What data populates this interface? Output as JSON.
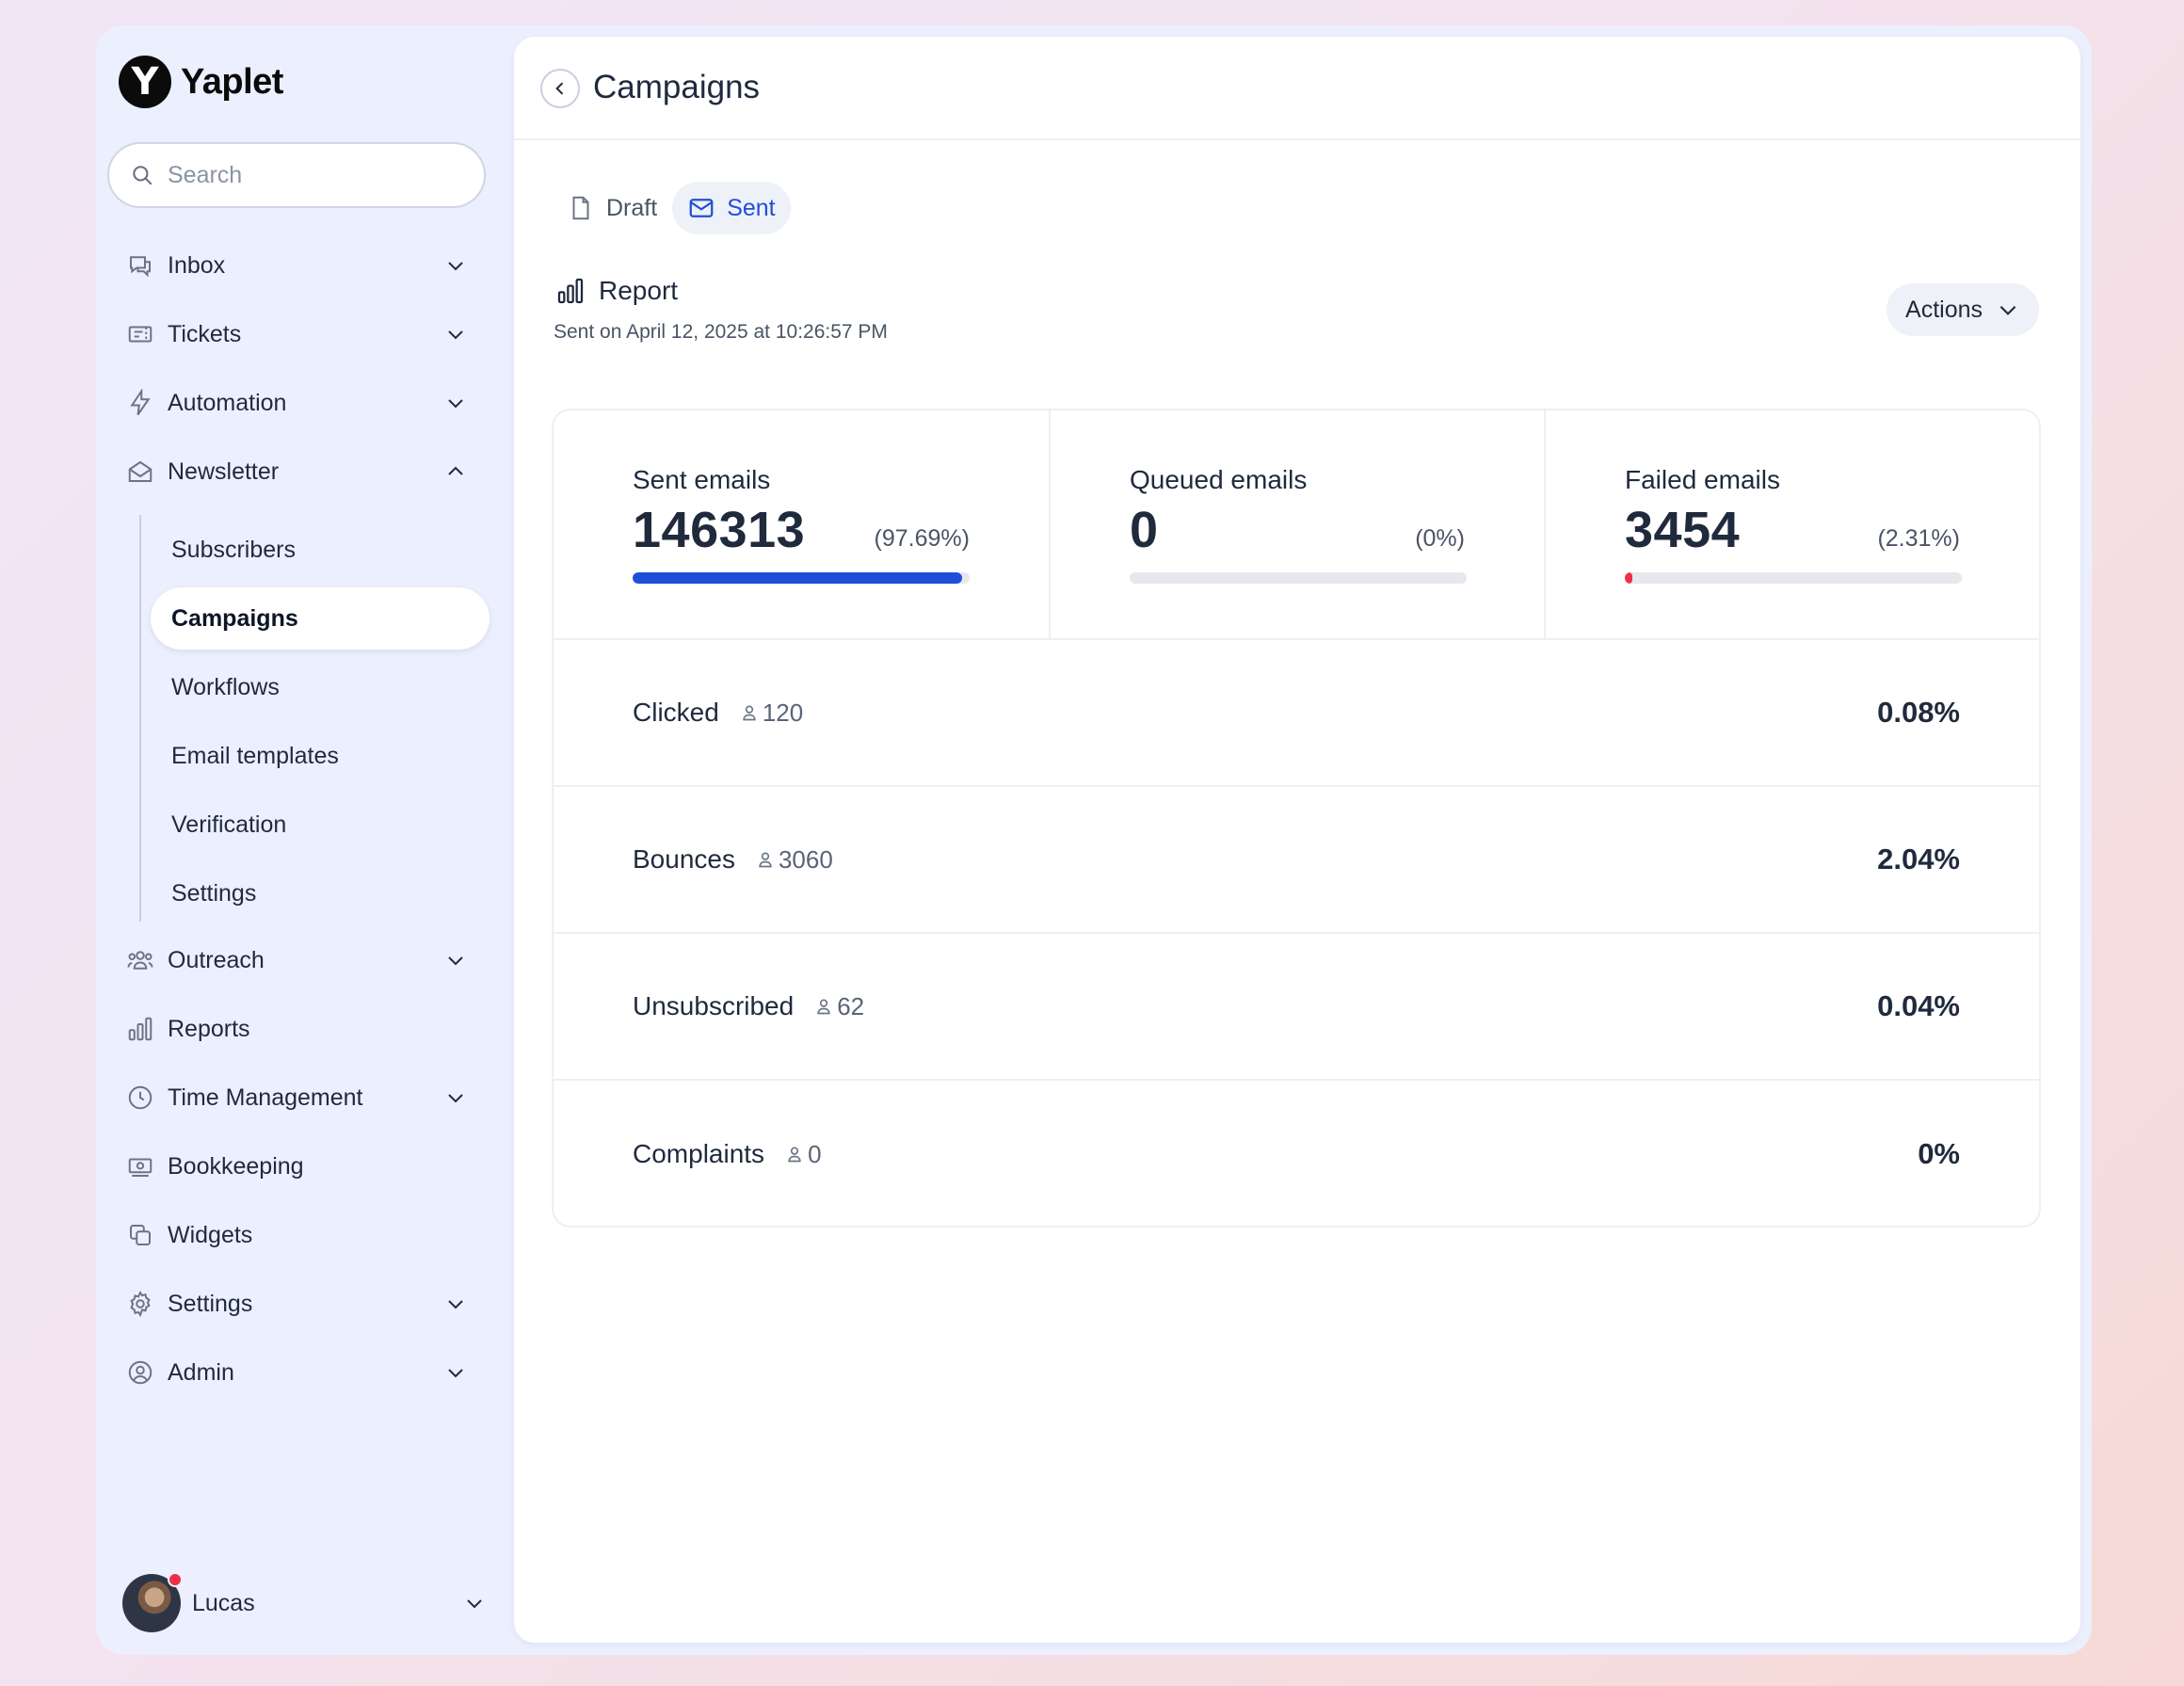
{
  "brand": {
    "name": "Yaplet",
    "mark": "Y"
  },
  "search": {
    "placeholder": "Search",
    "value": ""
  },
  "sidebar": {
    "items": [
      {
        "label": "Inbox",
        "icon": "chat-icon",
        "expandable": true
      },
      {
        "label": "Tickets",
        "icon": "ticket-icon",
        "expandable": true
      },
      {
        "label": "Automation",
        "icon": "lightning-icon",
        "expandable": true
      },
      {
        "label": "Newsletter",
        "icon": "envelope-open-icon",
        "expandable": true,
        "expanded": true
      },
      {
        "label": "Outreach",
        "icon": "users-icon",
        "expandable": true
      },
      {
        "label": "Reports",
        "icon": "bar-chart-icon",
        "expandable": false
      },
      {
        "label": "Time Management",
        "icon": "clock-icon",
        "expandable": true
      },
      {
        "label": "Bookkeeping",
        "icon": "money-icon",
        "expandable": false
      },
      {
        "label": "Widgets",
        "icon": "widgets-icon",
        "expandable": false
      },
      {
        "label": "Settings",
        "icon": "gear-icon",
        "expandable": true
      },
      {
        "label": "Admin",
        "icon": "user-circle-icon",
        "expandable": true
      }
    ],
    "newsletter_sub": [
      {
        "label": "Subscribers"
      },
      {
        "label": "Campaigns",
        "active": true
      },
      {
        "label": "Workflows"
      },
      {
        "label": "Email templates"
      },
      {
        "label": "Verification"
      },
      {
        "label": "Settings"
      }
    ]
  },
  "user": {
    "name": "Lucas",
    "status_color": "#ef2f43"
  },
  "header": {
    "title": "Campaigns"
  },
  "tabs": [
    {
      "label": "Draft",
      "icon": "document-icon",
      "active": false
    },
    {
      "label": "Sent",
      "icon": "envelope-icon",
      "active": true
    }
  ],
  "report": {
    "title": "Report",
    "subtitle": "Sent on April 12, 2025 at 10:26:57 PM",
    "actions_label": "Actions"
  },
  "stats": [
    {
      "label": "Sent emails",
      "value": "146313",
      "percent": "(97.69%)",
      "fill_fraction": 0.9769,
      "color": "#1f4fd8"
    },
    {
      "label": "Queued emails",
      "value": "0",
      "percent": "(0%)",
      "fill_fraction": 0,
      "color": "#1f4fd8"
    },
    {
      "label": "Failed emails",
      "value": "3454",
      "percent": "(2.31%)",
      "fill_fraction": 0.0231,
      "color": "#ef2f43"
    }
  ],
  "metrics": [
    {
      "label": "Clicked",
      "count": "120",
      "percent": "0.08%"
    },
    {
      "label": "Bounces",
      "count": "3060",
      "percent": "2.04%"
    },
    {
      "label": "Unsubscribed",
      "count": "62",
      "percent": "0.04%"
    },
    {
      "label": "Complaints",
      "count": "0",
      "percent": "0%"
    }
  ],
  "colors": {
    "accent": "#1f4fd8",
    "danger": "#ef2f43",
    "sidebar_bg": "#eceffd"
  }
}
